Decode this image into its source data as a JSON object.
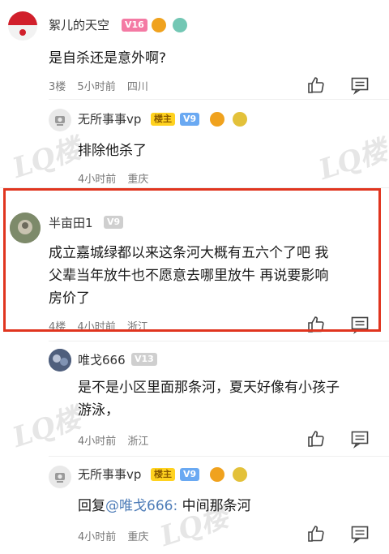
{
  "comments": [
    {
      "username": "絮儿的天空",
      "level": "V16",
      "text": "是自杀还是意外啊?",
      "floor": "3楼",
      "time": "5小时前",
      "location": "四川"
    },
    {
      "username": "无所事事vp",
      "owner_badge": "楼主",
      "level": "V9",
      "text": "排除他杀了",
      "time": "4小时前",
      "location": "重庆"
    },
    {
      "username": "半亩田1",
      "level": "V9",
      "text_line1": "成立嘉城绿都以来这条河大概有五六个了吧 我",
      "text_line2": "父辈当年放牛也不愿意去哪里放牛 再说要影响",
      "text_line3": "房价了",
      "floor": "4楼",
      "time": "4小时前",
      "location": "浙江"
    },
    {
      "username": "唯戈666",
      "level": "V13",
      "text_line1": "是不是小区里面那条河，夏天好像有小孩子",
      "text_line2": "游泳，",
      "time": "4小时前",
      "location": "浙江"
    },
    {
      "username": "无所事事vp",
      "owner_badge": "楼主",
      "level": "V9",
      "reply_prefix": "回复",
      "mention": "@唯戈666:",
      "reply_text": "中间那条河",
      "time": "4小时前",
      "location": "重庆"
    }
  ],
  "colors": {
    "highlight": "#e0351f",
    "level_high": "#f47aa4",
    "level_mid": "#6aa9f2",
    "level_gray": "#cfcfcf",
    "owner_badge": "#ffd21f",
    "mention": "#4f7db8"
  },
  "icons": [
    "like-icon",
    "comment-icon"
  ]
}
